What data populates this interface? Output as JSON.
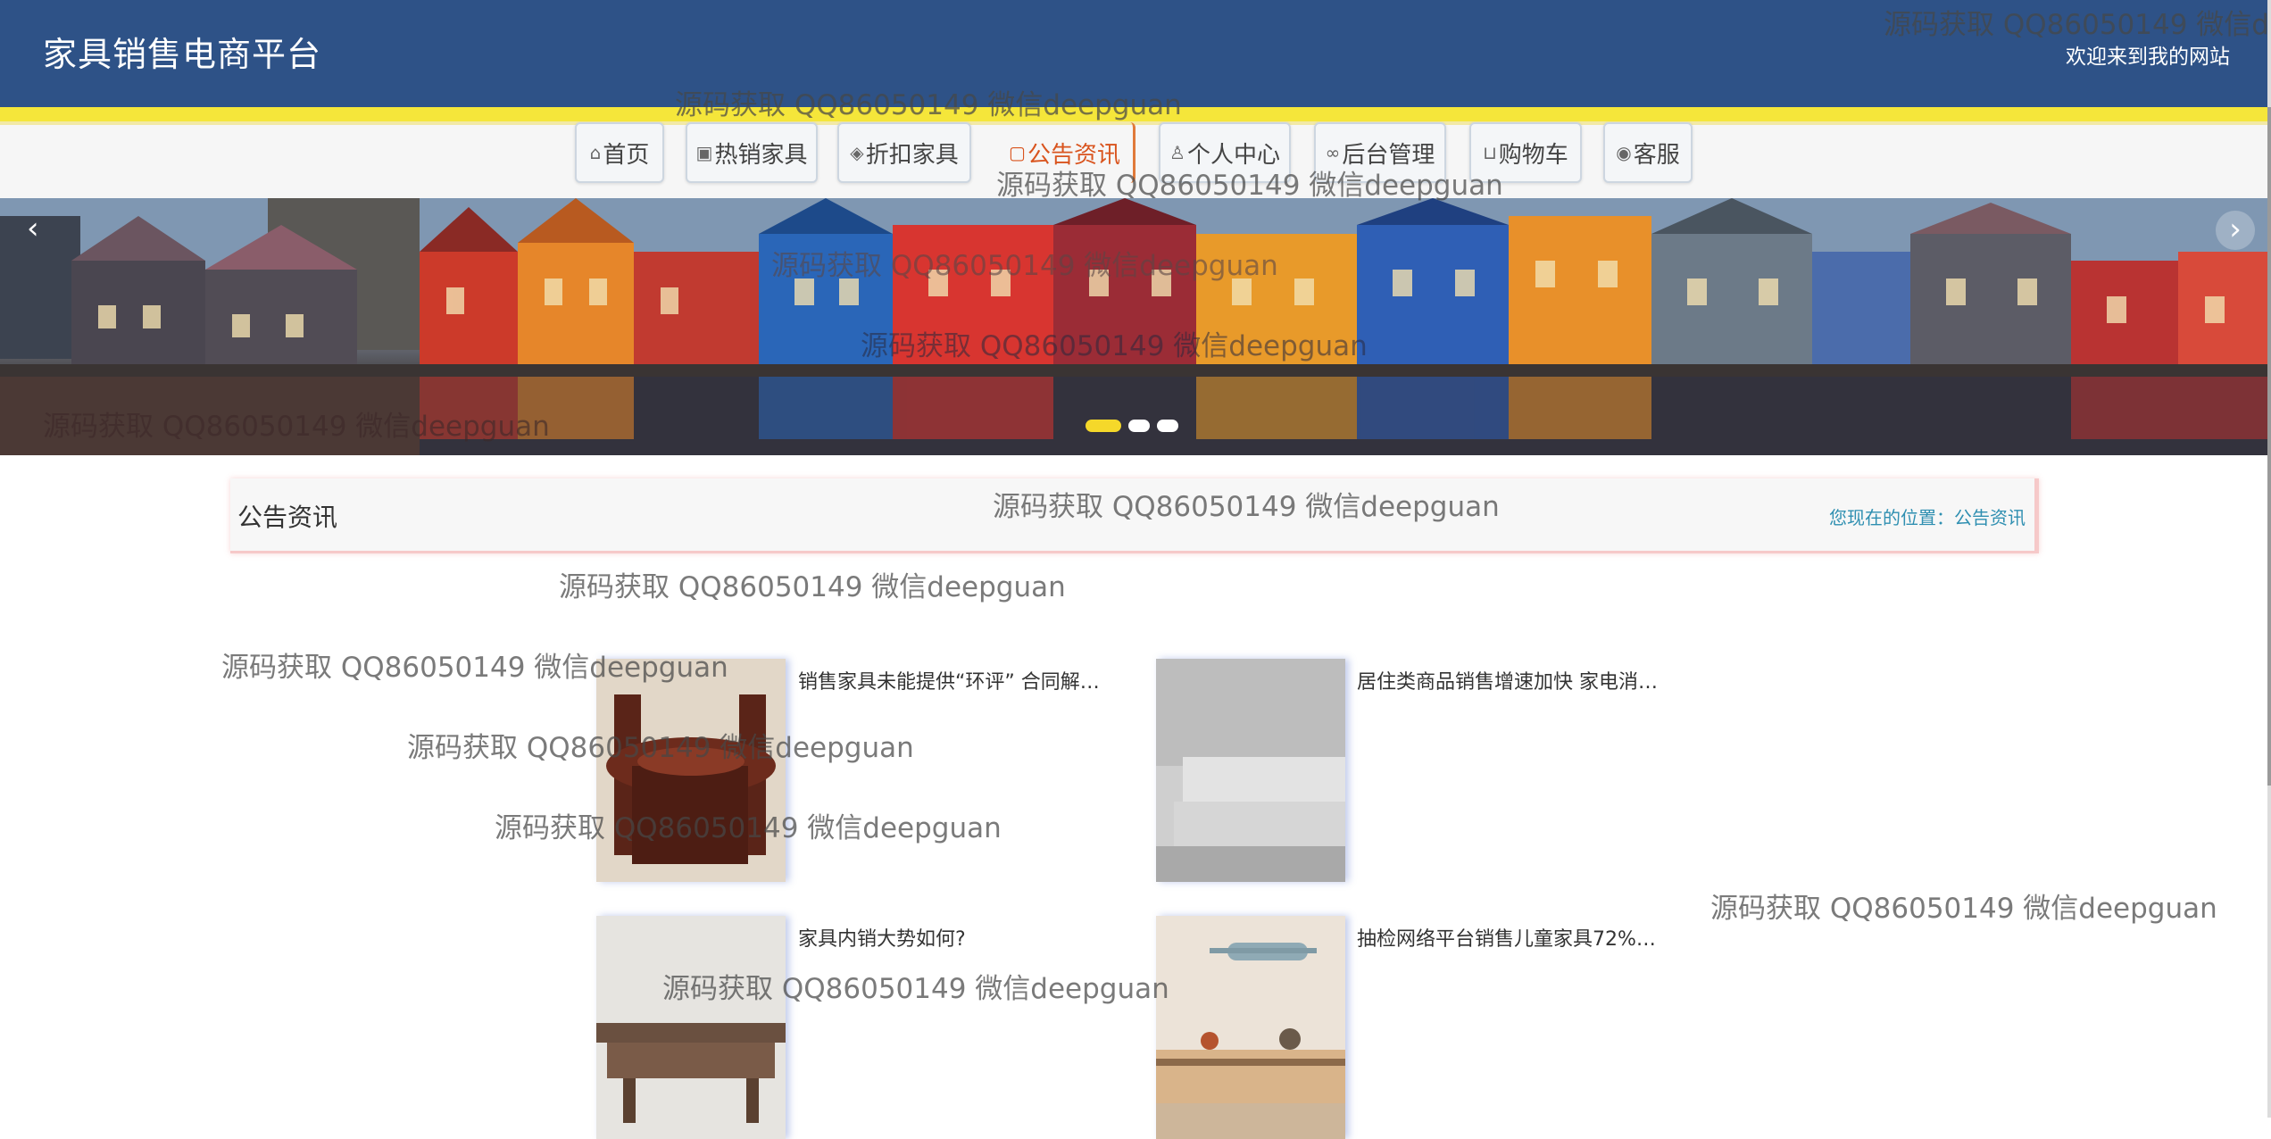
{
  "header": {
    "site_title": "家具销售电商平台",
    "welcome": "欢迎来到我的网站",
    "bg_color": "#2e5287",
    "stripe_color": "#f5e63a"
  },
  "nav": {
    "items": [
      {
        "icon": "home-icon",
        "glyph": "⌂",
        "label": "首页"
      },
      {
        "icon": "hot-icon",
        "glyph": "▣",
        "label": "热销家具"
      },
      {
        "icon": "discount-icon",
        "glyph": "◈",
        "label": "折扣家具"
      },
      {
        "icon": "notice-icon",
        "glyph": "▢",
        "label": "公告资讯"
      },
      {
        "icon": "user-icon",
        "glyph": "♙",
        "label": "个人中心"
      },
      {
        "icon": "link-icon",
        "glyph": "∞",
        "label": "后台管理"
      },
      {
        "icon": "cart-icon",
        "glyph": "⊔",
        "label": "购物车"
      },
      {
        "icon": "chat-icon",
        "glyph": "◉",
        "label": "客服"
      }
    ],
    "active_index": 3,
    "active_color": "#d9541e"
  },
  "banner": {
    "prev_label": "‹",
    "next_label": "›",
    "slide_count": 3,
    "active_slide": 1
  },
  "breadcrumb": {
    "title": "公告资讯",
    "location": "您现在的位置：公告资讯"
  },
  "news": [
    {
      "title": "销售家具未能提供“环评” 合同解…",
      "image": "dining-table"
    },
    {
      "title": "居住类商品销售增速加快 家电消…",
      "image": "white-sofa"
    },
    {
      "title": "家具内销大势如何?",
      "image": "wooden-cabinet"
    },
    {
      "title": "抽检网络平台销售儿童家具72%…",
      "image": "tv-cabinet"
    }
  ],
  "watermark_text": "源码获取 QQ86050149 微信deepguan",
  "watermark_text_cut": "源码获取 QQ86050149 微信dee"
}
